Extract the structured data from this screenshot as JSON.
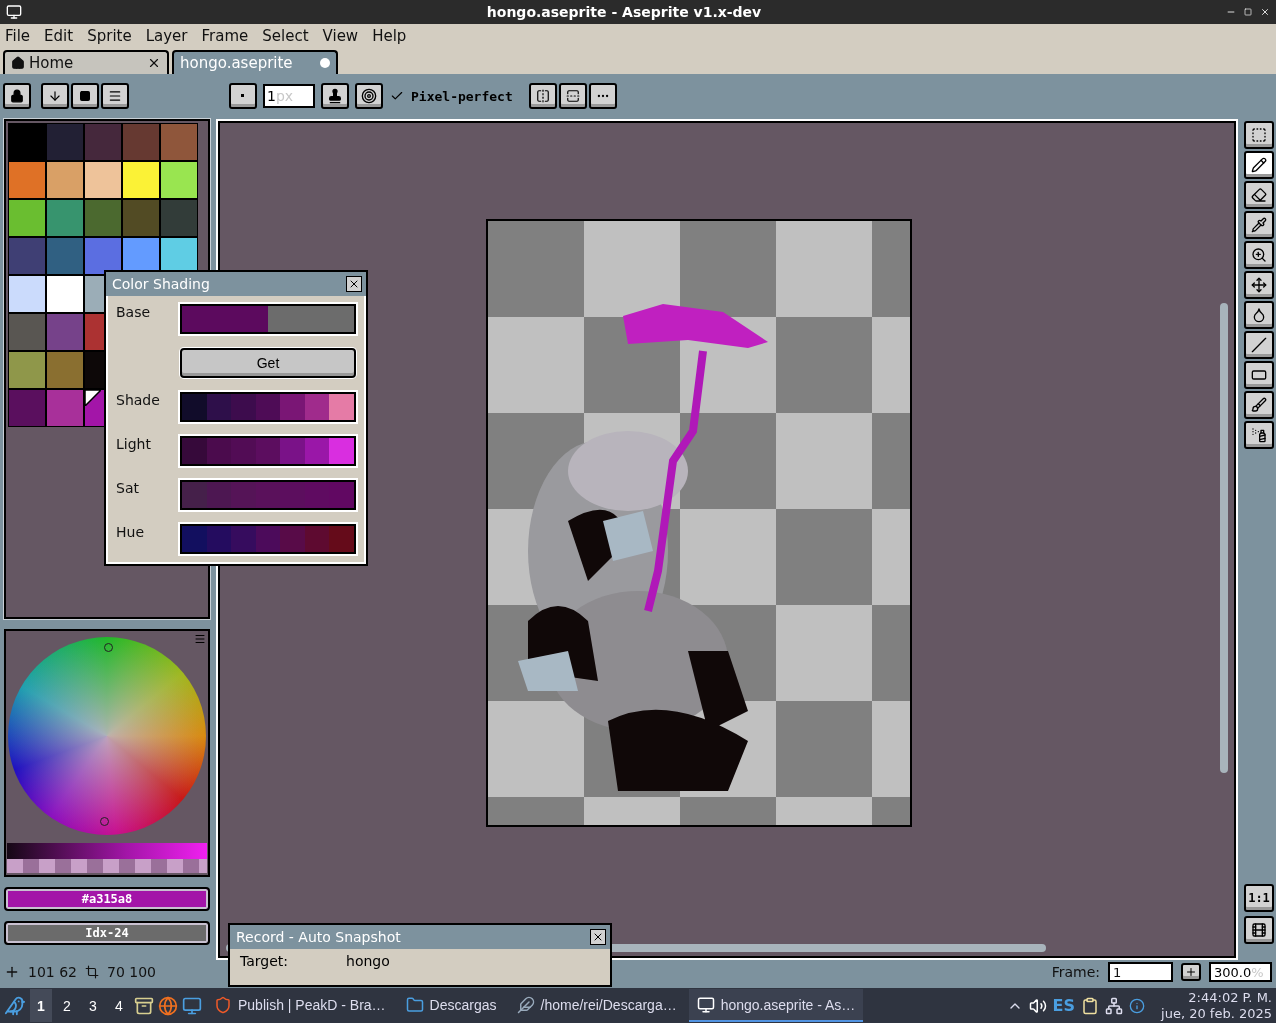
{
  "window": {
    "title": "hongo.aseprite - Aseprite v1.x-dev"
  },
  "menu": [
    "File",
    "Edit",
    "Sprite",
    "Layer",
    "Frame",
    "Select",
    "View",
    "Help"
  ],
  "tabs": [
    {
      "label": "Home",
      "kind": "home",
      "selected": false
    },
    {
      "label": "hongo.aseprite",
      "kind": "document",
      "selected": true
    }
  ],
  "toolbar": {
    "brush_size": {
      "value": "1",
      "unit": "px"
    },
    "pixel_perfect": {
      "label": "Pixel-perfect",
      "checked": true
    }
  },
  "palette": [
    [
      {
        "color": "#000000",
        "selected": false
      },
      {
        "color": "#222034",
        "selected": false
      },
      {
        "color": "#45283c",
        "selected": false
      },
      {
        "color": "#663931",
        "selected": false
      },
      {
        "color": "#8f563b",
        "selected": false
      }
    ],
    [
      {
        "color": "#df7126",
        "selected": false
      },
      {
        "color": "#d9a066",
        "selected": false
      },
      {
        "color": "#eec39a",
        "selected": false
      },
      {
        "color": "#fbf236",
        "selected": false
      },
      {
        "color": "#99e550",
        "selected": false
      }
    ],
    [
      {
        "color": "#6abe30",
        "selected": false
      },
      {
        "color": "#37946e",
        "selected": false
      },
      {
        "color": "#4b692f",
        "selected": false
      },
      {
        "color": "#524b24",
        "selected": false
      },
      {
        "color": "#323c39",
        "selected": false
      }
    ],
    [
      {
        "color": "#3f3f74",
        "selected": false
      },
      {
        "color": "#306082",
        "selected": false
      },
      {
        "color": "#5b6ee1",
        "selected": false
      },
      {
        "color": "#639bff",
        "selected": false
      },
      {
        "color": "#5fcde4",
        "selected": false
      }
    ],
    [
      {
        "color": "#cbdbfc",
        "selected": false
      },
      {
        "color": "#ffffff",
        "selected": false
      },
      {
        "color": "#9badb7",
        "selected": false
      }
    ],
    [
      {
        "color": "#595652",
        "selected": false
      },
      {
        "color": "#76428a",
        "selected": false
      },
      {
        "color": "#ac3232",
        "selected": false
      }
    ],
    [
      {
        "color": "#8f974a",
        "selected": false
      },
      {
        "color": "#8a6f30",
        "selected": false
      },
      {
        "color": "#0d0808",
        "selected": false
      }
    ],
    [
      {
        "color": "#5a0f5e",
        "selected": false
      },
      {
        "color": "#a8309a",
        "selected": false
      },
      {
        "color": "#a315a8",
        "selected": true
      }
    ]
  ],
  "color_shading": {
    "title": "Color Shading",
    "base": {
      "label": "Base",
      "colors": [
        {
          "color": "#5c0a5e"
        },
        {
          "color": "#6c6c6c"
        }
      ]
    },
    "get_button": "Get",
    "rows": [
      {
        "label": "Shade",
        "colors": [
          {
            "color": "#110c2a"
          },
          {
            "color": "#2e0f4a"
          },
          {
            "color": "#3d0c4d"
          },
          {
            "color": "#4e0c56"
          },
          {
            "color": "#7a1675"
          },
          {
            "color": "#a02b8c"
          },
          {
            "color": "#e57ba6"
          }
        ]
      },
      {
        "label": "Light",
        "colors": [
          {
            "color": "#36093a"
          },
          {
            "color": "#4b0b4d"
          },
          {
            "color": "#520c55"
          },
          {
            "color": "#5c0d5f"
          },
          {
            "color": "#7a1288"
          },
          {
            "color": "#9a17a8"
          },
          {
            "color": "#d92ee0"
          }
        ]
      },
      {
        "label": "Sat",
        "colors": [
          {
            "color": "#45204a"
          },
          {
            "color": "#4d1752"
          },
          {
            "color": "#551457"
          },
          {
            "color": "#5a115b"
          },
          {
            "color": "#5c0e5e"
          },
          {
            "color": "#5f0b61"
          },
          {
            "color": "#610862"
          }
        ]
      },
      {
        "label": "Hue",
        "colors": [
          {
            "color": "#120f5f"
          },
          {
            "color": "#240c5f"
          },
          {
            "color": "#360c5e"
          },
          {
            "color": "#4c0b5b"
          },
          {
            "color": "#580b48"
          },
          {
            "color": "#5e0a30"
          },
          {
            "color": "#650b1a"
          }
        ]
      }
    ]
  },
  "color_fields": {
    "hex": "#a315a8",
    "index": "Idx-24"
  },
  "tools": [
    {
      "kind": "marquee",
      "selected": false
    },
    {
      "kind": "pencil",
      "selected": true
    },
    {
      "kind": "eraser",
      "selected": false
    },
    {
      "kind": "eyedropper",
      "selected": false
    },
    {
      "kind": "zoom",
      "selected": false
    },
    {
      "kind": "move",
      "selected": false
    },
    {
      "kind": "bucket",
      "selected": false
    },
    {
      "kind": "line",
      "selected": false
    },
    {
      "kind": "rectangle",
      "selected": false
    },
    {
      "kind": "contour",
      "selected": false
    },
    {
      "kind": "spray",
      "selected": false
    }
  ],
  "canvas_buttons": {
    "actual_size": "1:1"
  },
  "status": {
    "cursor": "101 62",
    "size": "70 100",
    "frame_label": "Frame:",
    "frame_value": "1",
    "zoom": "300.0",
    "zoom_unit": "%"
  },
  "record_panel": {
    "title": "Record - Auto Snapshot",
    "target_label": "Target:",
    "target_value": "hongo"
  },
  "taskbar": {
    "workspaces": [
      {
        "label": "1",
        "selected": true
      },
      {
        "label": "2",
        "selected": false
      },
      {
        "label": "3",
        "selected": false
      },
      {
        "label": "4",
        "selected": false
      }
    ],
    "tasks": [
      {
        "label": "Publish | PeakD - Bra…",
        "kind": "browser",
        "selected": false
      },
      {
        "label": "Descargas",
        "kind": "folder",
        "selected": false
      },
      {
        "label": "/home/rei/Descarga…",
        "kind": "editor",
        "selected": false
      },
      {
        "label": "hongo.aseprite - As…",
        "kind": "aseprite",
        "selected": true
      }
    ],
    "language": "ES",
    "clock": {
      "time": "2:44:02 P. M.",
      "date": "jue, 20 feb. 2025"
    }
  }
}
